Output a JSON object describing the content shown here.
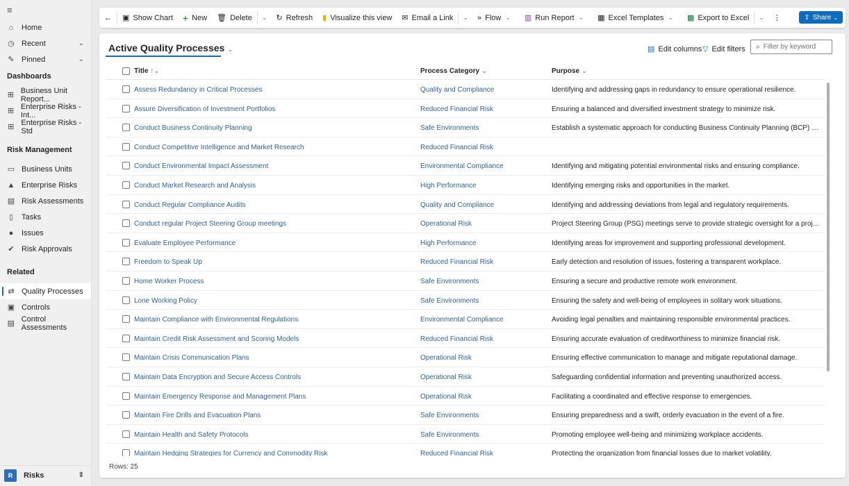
{
  "sidebar": {
    "menu_icon": "hamburger-icon",
    "top": [
      {
        "label": "Home",
        "icon": "home-icon"
      },
      {
        "label": "Recent",
        "icon": "clock-icon"
      },
      {
        "label": "Pinned",
        "icon": "pin-icon"
      }
    ],
    "sections": [
      {
        "title": "Dashboards",
        "items": [
          {
            "label": "Business Unit Report...",
            "icon": "dashboard-icon"
          },
          {
            "label": "Enterprise Risks - Int...",
            "icon": "dashboard-icon"
          },
          {
            "label": "Enterprise Risks - Std",
            "icon": "dashboard-icon"
          }
        ]
      },
      {
        "title": "Risk Management",
        "items": [
          {
            "label": "Business Units",
            "icon": "briefcase-icon"
          },
          {
            "label": "Enterprise Risks",
            "icon": "warning-icon"
          },
          {
            "label": "Risk Assessments",
            "icon": "clipboard-icon"
          },
          {
            "label": "Tasks",
            "icon": "page-icon"
          },
          {
            "label": "Issues",
            "icon": "exclamation-icon"
          },
          {
            "label": "Risk Approvals",
            "icon": "check-circle-icon"
          }
        ]
      },
      {
        "title": "Related",
        "items": [
          {
            "label": "Quality Processes",
            "icon": "process-icon",
            "active": true
          },
          {
            "label": "Controls",
            "icon": "control-icon"
          },
          {
            "label": "Control Assessments",
            "icon": "clipboard-icon"
          }
        ]
      }
    ],
    "area": {
      "badge": "R",
      "label": "Risks"
    }
  },
  "toolbar": {
    "show_chart": "Show Chart",
    "new": "New",
    "delete": "Delete",
    "refresh": "Refresh",
    "visualize": "Visualize this view",
    "email_link": "Email a Link",
    "flow": "Flow",
    "run_report": "Run Report",
    "excel_templates": "Excel Templates",
    "export_excel": "Export to Excel",
    "share": "Share"
  },
  "view": {
    "title": "Active Quality Processes",
    "edit_columns": "Edit columns",
    "edit_filters": "Edit filters",
    "filter_placeholder": "Filter by keyword",
    "columns": {
      "title": "Title",
      "category": "Process Category",
      "purpose": "Purpose"
    },
    "sort": "ascending",
    "rows": [
      [
        "Assess Redundancy in Critical Processes",
        "Quality and Compliance",
        "Identifying and addressing gaps in redundancy to ensure operational resilience."
      ],
      [
        "Assure Diversification of Investment Portfolios",
        "Reduced Financial Risk",
        "Ensuring a balanced and diversified investment strategy to minimize risk."
      ],
      [
        "Conduct Business Continuity Planning",
        "Safe Environments",
        "Establish a systematic approach for conducting Business Continuity Planning (BCP) within th..."
      ],
      [
        "Conduct Competitive Intelligence and Market Research",
        "Reduced Financial Risk",
        ""
      ],
      [
        "Conduct Environmental Impact Assessment",
        "Environmental Compliance",
        "Identifying and mitigating potential environmental risks and ensuring compliance."
      ],
      [
        "Conduct Market Research and Analysis",
        "High Performance",
        "Identifying emerging risks and opportunities in the market."
      ],
      [
        "Conduct Regular Compliance Audits",
        "Quality and Compliance",
        "Identifying and addressing deviations from legal and regulatory requirements."
      ],
      [
        "Conduct regular Project Steering Group meetings",
        "Operational Risk",
        "Project Steering Group (PSG) meetings serve to provide strategic oversight for a project. The..."
      ],
      [
        "Evaluate Employee Performance",
        "High Performance",
        "Identifying areas for improvement and supporting professional development."
      ],
      [
        "Freedom to Speak Up",
        "Reduced Financial Risk",
        "Early detection and resolution of issues, fostering a transparent workplace."
      ],
      [
        "Home Worker Process",
        "Safe Environments",
        "Ensuring a secure and productive remote work environment."
      ],
      [
        "Lone Working Policy",
        "Safe Environments",
        "Ensuring the safety and well-being of employees in solitary work situations."
      ],
      [
        "Maintain Compliance with Environmental Regulations",
        "Environmental Compliance",
        "Avoiding legal penalties and maintaining responsible environmental practices."
      ],
      [
        "Maintain Credit Risk Assessment and Scoring Models",
        "Reduced Financial Risk",
        "Ensuring accurate evaluation of creditworthiness to minimize financial risk."
      ],
      [
        "Maintain Crisis Communication Plans",
        "Operational Risk",
        "Ensuring effective communication to manage and mitigate reputational damage."
      ],
      [
        "Maintain Data Encryption and Secure Access Controls",
        "Operational Risk",
        "Safeguarding confidential information and preventing unauthorized access."
      ],
      [
        "Maintain Emergency Response and Management Plans",
        "Operational Risk",
        "Facilitating a coordinated and effective response to emergencies."
      ],
      [
        "Maintain Fire Drills and Evacuation Plans",
        "Safe Environments",
        "Ensuring preparedness and a swift, orderly evacuation in the event of a fire."
      ],
      [
        "Maintain Health and Safety Protocols",
        "Safe Environments",
        "Promoting employee well-being and minimizing workplace accidents."
      ],
      [
        "Maintain Hedging Strategies for Currency and Commodity Risk",
        "Reduced Financial Risk",
        "Protecting the organization from financial losses due to market volatility."
      ]
    ],
    "row_count": "Rows: 25"
  },
  "colors": {
    "accent": "#0f6cbd",
    "link": "#2e5f9e"
  }
}
